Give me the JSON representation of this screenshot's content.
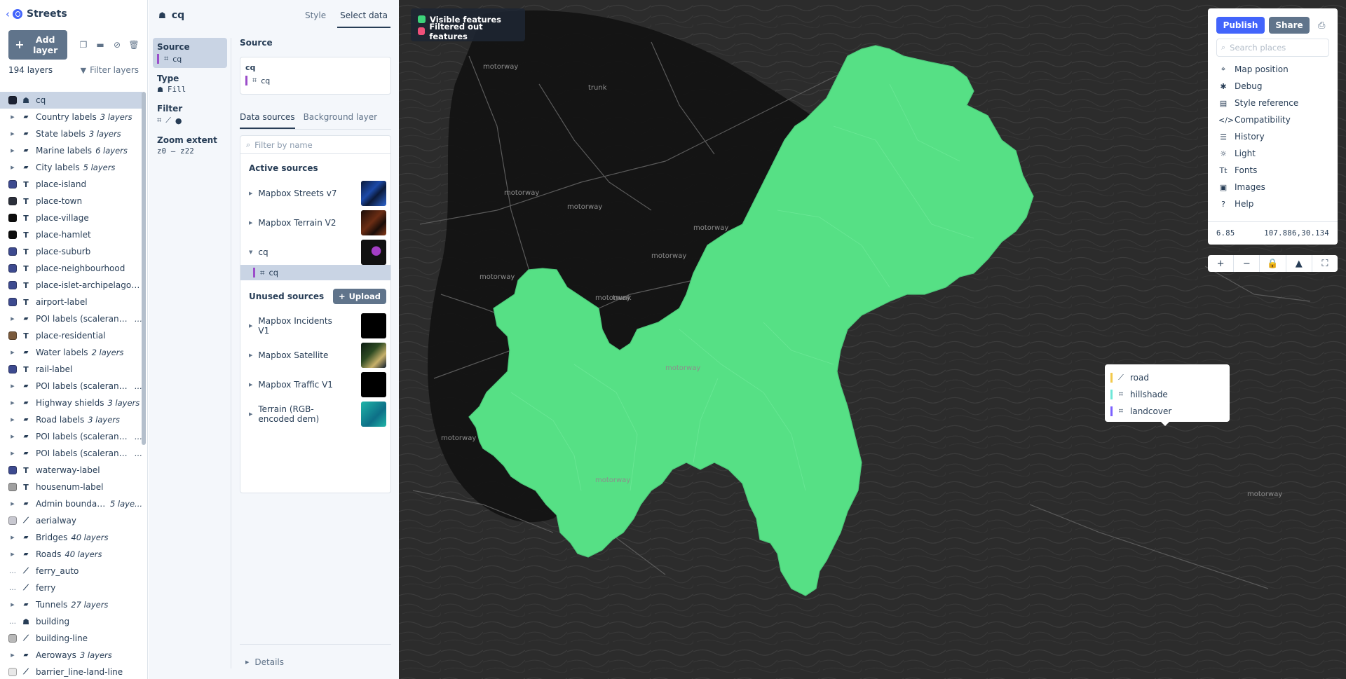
{
  "app": {
    "back_glyph": "‹",
    "style_name": "Streets",
    "add_layer_label": "Add layer",
    "layer_count": "194 layers",
    "filter_layers_label": "Filter layers"
  },
  "layers": [
    {
      "name": "cq",
      "kind": "layer",
      "type": "fill",
      "swatch": "#1c2233",
      "selected": true
    },
    {
      "name": "Country labels",
      "kind": "group",
      "sub": "3 layers"
    },
    {
      "name": "State labels",
      "kind": "group",
      "sub": "3 layers"
    },
    {
      "name": "Marine labels",
      "kind": "group",
      "sub": "6 layers"
    },
    {
      "name": "City labels",
      "kind": "group",
      "sub": "5 layers"
    },
    {
      "name": "place-island",
      "kind": "layer",
      "type": "symbol",
      "swatch": "#3d4a8f"
    },
    {
      "name": "place-town",
      "kind": "layer",
      "type": "symbol",
      "swatch": "#2b2f3a"
    },
    {
      "name": "place-village",
      "kind": "layer",
      "type": "symbol",
      "swatch": "#0c0c0c"
    },
    {
      "name": "place-hamlet",
      "kind": "layer",
      "type": "symbol",
      "swatch": "#0c0c0c"
    },
    {
      "name": "place-suburb",
      "kind": "layer",
      "type": "symbol",
      "swatch": "#3d4a8f"
    },
    {
      "name": "place-neighbourhood",
      "kind": "layer",
      "type": "symbol",
      "swatch": "#3d4a8f"
    },
    {
      "name": "place-islet-archipelago-...",
      "kind": "layer",
      "type": "symbol",
      "swatch": "#3d4a8f"
    },
    {
      "name": "airport-label",
      "kind": "layer",
      "type": "symbol",
      "swatch": "#3d4a8f"
    },
    {
      "name": "POI labels (scalerank 1)",
      "kind": "group",
      "sub": "..."
    },
    {
      "name": "place-residential",
      "kind": "layer",
      "type": "symbol",
      "swatch": "#7a5a3c"
    },
    {
      "name": "Water labels",
      "kind": "group",
      "sub": "2 layers"
    },
    {
      "name": "rail-label",
      "kind": "layer",
      "type": "symbol",
      "swatch": "#3d4a8f"
    },
    {
      "name": "POI labels (scalerank 2)",
      "kind": "group",
      "sub": "..."
    },
    {
      "name": "Highway shields",
      "kind": "group",
      "sub": "3 layers"
    },
    {
      "name": "Road labels",
      "kind": "group",
      "sub": "3 layers"
    },
    {
      "name": "POI labels (scalerank 3)",
      "kind": "group",
      "sub": "..."
    },
    {
      "name": "POI labels (scalerank 4)",
      "kind": "group",
      "sub": "..."
    },
    {
      "name": "waterway-label",
      "kind": "layer",
      "type": "symbol",
      "swatch": "#3d4a8f"
    },
    {
      "name": "housenum-label",
      "kind": "layer",
      "type": "symbol",
      "swatch": "#a0a0a0"
    },
    {
      "name": "Admin boundaries",
      "kind": "group",
      "sub": "5 laye..."
    },
    {
      "name": "aerialway",
      "kind": "layer",
      "type": "line",
      "swatch": "#c8c8d0"
    },
    {
      "name": "Bridges",
      "kind": "group",
      "sub": "40 layers"
    },
    {
      "name": "Roads",
      "kind": "group",
      "sub": "40 layers"
    },
    {
      "name": "ferry_auto",
      "kind": "layer",
      "type": "line",
      "swatch": null
    },
    {
      "name": "ferry",
      "kind": "layer",
      "type": "line",
      "swatch": null
    },
    {
      "name": "Tunnels",
      "kind": "group",
      "sub": "27 layers"
    },
    {
      "name": "building",
      "kind": "layer",
      "type": "fill",
      "swatch": null
    },
    {
      "name": "building-line",
      "kind": "layer",
      "type": "line",
      "swatch": "#b8b8b8"
    },
    {
      "name": "Aeroways",
      "kind": "group",
      "sub": "3 layers"
    },
    {
      "name": "barrier_line-land-line",
      "kind": "layer",
      "type": "line",
      "swatch": "#e8e8e8"
    }
  ],
  "editor": {
    "layer_name": "cq",
    "tabs": [
      "Style",
      "Select data"
    ],
    "active_tab": "Select data",
    "nav": {
      "source_label": "Source",
      "source_value": "cq",
      "type_label": "Type",
      "type_value": "Fill",
      "filter_label": "Filter",
      "zoom_label": "Zoom extent",
      "zoom_value": "z0 – z22"
    },
    "source_section_title": "Source",
    "current_source": {
      "name": "cq",
      "layer": "cq"
    },
    "subtabs": [
      "Data sources",
      "Background layer"
    ],
    "filter_placeholder": "Filter by name",
    "active_sources_title": "Active sources",
    "active_sources": [
      {
        "name": "Mapbox Streets v7",
        "expanded": false
      },
      {
        "name": "Mapbox Terrain V2",
        "expanded": false
      },
      {
        "name": "cq",
        "expanded": true,
        "sub_layer": "cq"
      }
    ],
    "unused_sources_title": "Unused sources",
    "upload_label": "Upload",
    "unused_sources": [
      {
        "name": "Mapbox Incidents V1"
      },
      {
        "name": "Mapbox Satellite"
      },
      {
        "name": "Mapbox Traffic V1"
      },
      {
        "name": "Terrain (RGB-encoded dem)"
      }
    ],
    "details_label": "Details"
  },
  "map": {
    "legend": [
      {
        "label": "Visible features",
        "color": "#3dd37a"
      },
      {
        "label": "Filtered out features",
        "color": "#f0507a"
      }
    ],
    "fill_color": "#56e085",
    "labels": [
      "motorway",
      "trunk",
      "motorway",
      "motorway",
      "motorway",
      "motorway",
      "motorway",
      "motorway",
      "motorway",
      "motorway",
      "trunk",
      "motorway",
      "motorway"
    ],
    "popup_features": [
      {
        "name": "road",
        "color": "#f2c94c",
        "icon": "line"
      },
      {
        "name": "hillshade",
        "color": "#6ee7d8",
        "icon": "fill"
      },
      {
        "name": "landcover",
        "color": "#7b61ff",
        "icon": "fill"
      }
    ]
  },
  "toolbar": {
    "publish_label": "Publish",
    "share_label": "Share",
    "search_placeholder": "Search places",
    "menu": [
      {
        "label": "Map position",
        "icon": "crosshair-icon",
        "glyph": "⌖"
      },
      {
        "label": "Debug",
        "icon": "bug-icon",
        "glyph": "✱"
      },
      {
        "label": "Style reference",
        "icon": "book-icon",
        "glyph": "▤"
      },
      {
        "label": "Compatibility",
        "icon": "code-icon",
        "glyph": "</>"
      },
      {
        "label": "History",
        "icon": "history-icon",
        "glyph": "☰"
      },
      {
        "label": "Light",
        "icon": "sun-icon",
        "glyph": "☼"
      },
      {
        "label": "Fonts",
        "icon": "font-icon",
        "glyph": "Tt"
      },
      {
        "label": "Images",
        "icon": "image-icon",
        "glyph": "▣"
      },
      {
        "label": "Help",
        "icon": "help-icon",
        "glyph": "?"
      }
    ],
    "zoom": "6.85",
    "center": "107.886,30.134",
    "controls": [
      {
        "name": "zoom-in",
        "glyph": "+"
      },
      {
        "name": "zoom-out",
        "glyph": "−"
      },
      {
        "name": "lock",
        "glyph": "🔒"
      },
      {
        "name": "compass",
        "glyph": "▲"
      },
      {
        "name": "fullscreen",
        "glyph": "⛶"
      }
    ]
  }
}
